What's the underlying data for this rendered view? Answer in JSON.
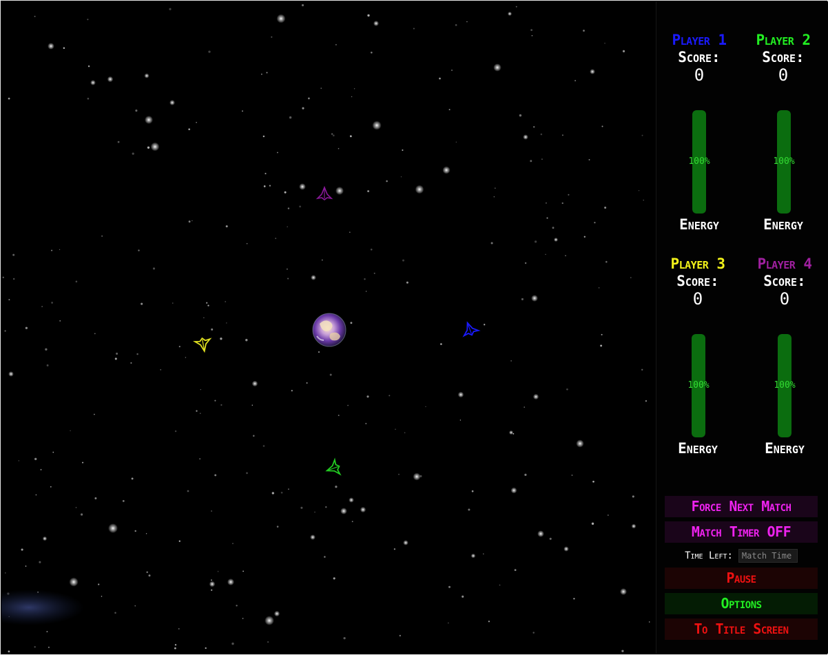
{
  "players": [
    {
      "name": "Player 1",
      "color": "#1a1aff",
      "score_label": "Score:",
      "score": "0",
      "energy_percent": 100,
      "energy_text": "100%",
      "energy_label": "Energy"
    },
    {
      "name": "Player 2",
      "color": "#22ee22",
      "score_label": "Score:",
      "score": "0",
      "energy_percent": 100,
      "energy_text": "100%",
      "energy_label": "Energy"
    },
    {
      "name": "Player 3",
      "color": "#f2f21a",
      "score_label": "Score:",
      "score": "0",
      "energy_percent": 100,
      "energy_text": "100%",
      "energy_label": "Energy"
    },
    {
      "name": "Player 4",
      "color": "#a020a0",
      "score_label": "Score:",
      "score": "0",
      "energy_percent": 100,
      "energy_text": "100%",
      "energy_label": "Energy"
    }
  ],
  "controls": {
    "force_next_match": "Force Next Match",
    "match_timer": "Match Timer OFF",
    "time_left_label": "Time Left:",
    "match_time_placeholder": "Match Time",
    "pause": "Pause",
    "options": "Options",
    "to_title_screen": "To Title Screen"
  },
  "colors": {
    "magenta_button_text": "#ee22ee",
    "magenta_button_bg": "#1a051a",
    "red_button_text": "#ee1111",
    "red_button_bg": "#1c0404",
    "green_button_text": "#22ee22",
    "green_button_bg": "#041c04",
    "energy_fill": "#0b6d0f"
  },
  "ships": [
    {
      "name": "player-1-ship",
      "color": "#1a1aff"
    },
    {
      "name": "player-2-ship",
      "color": "#22cc22"
    },
    {
      "name": "player-3-ship",
      "color": "#e0e020"
    },
    {
      "name": "player-4-ship",
      "color": "#8a1a9a"
    }
  ]
}
